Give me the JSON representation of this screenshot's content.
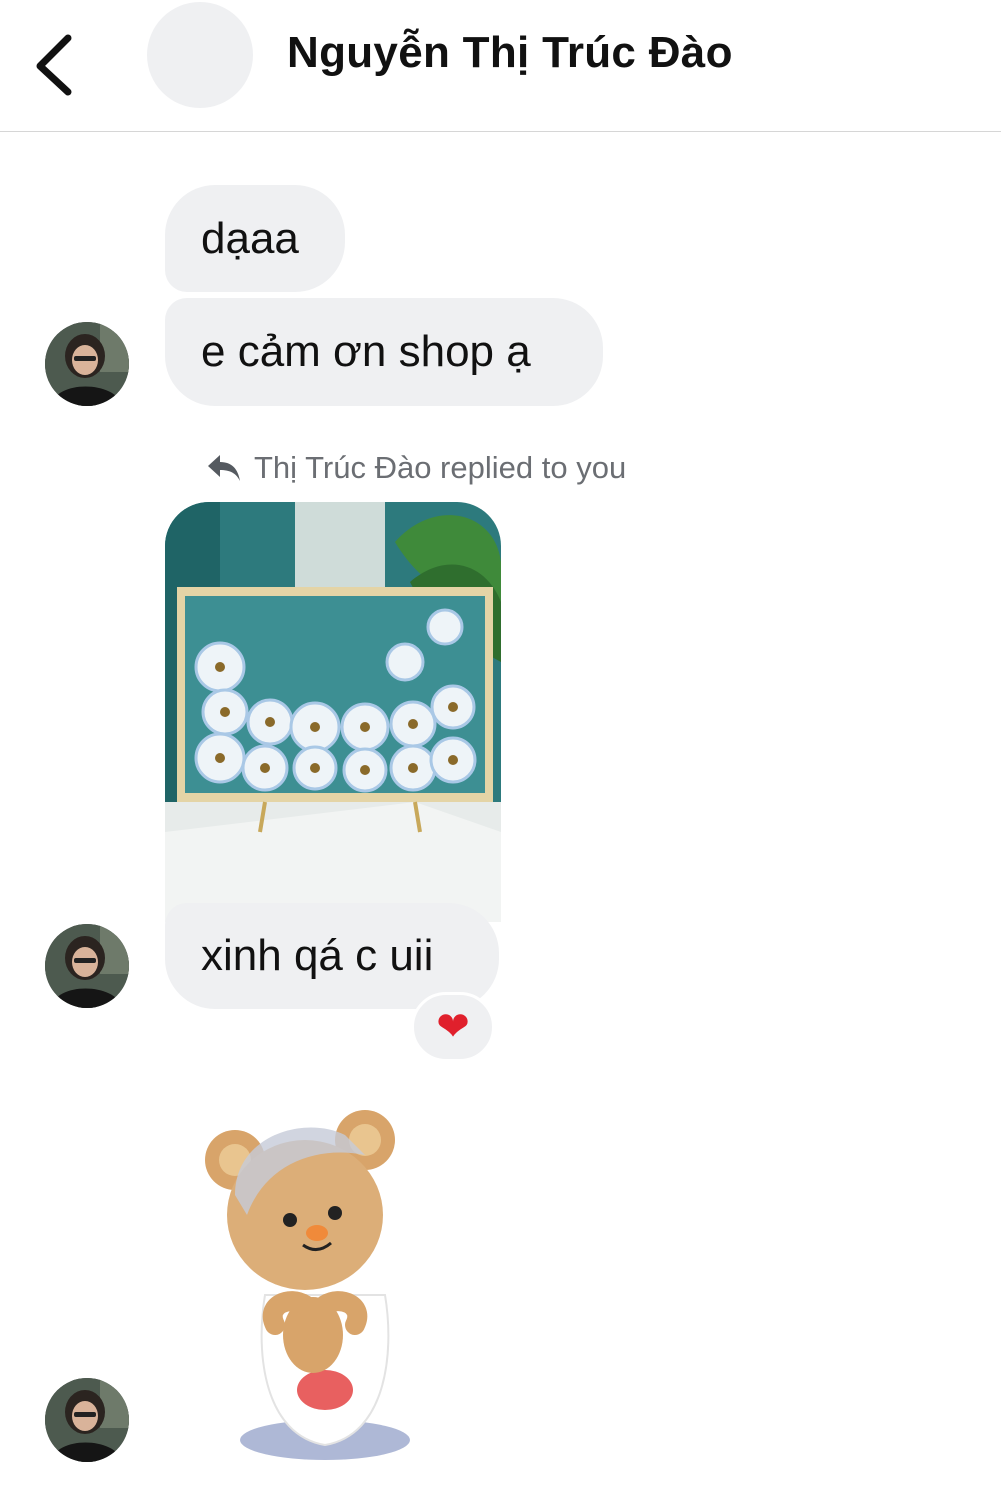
{
  "header": {
    "title": "Nguyễn Thị Trúc Đào"
  },
  "messages": [
    {
      "text": "dạaa"
    },
    {
      "text": "e cảm ơn shop ạ"
    },
    {
      "reply_label": "Thị Trúc Đào replied to you"
    },
    {
      "text": "xinh qá c uii",
      "reaction": "❤"
    }
  ],
  "icons": {
    "back": "chevron-left-icon",
    "reply": "reply-arrow-icon",
    "reaction": "heart-icon"
  },
  "colors": {
    "bubble": "#eff0f2",
    "meta_text": "#6b6e73",
    "heart": "#e0202c"
  }
}
